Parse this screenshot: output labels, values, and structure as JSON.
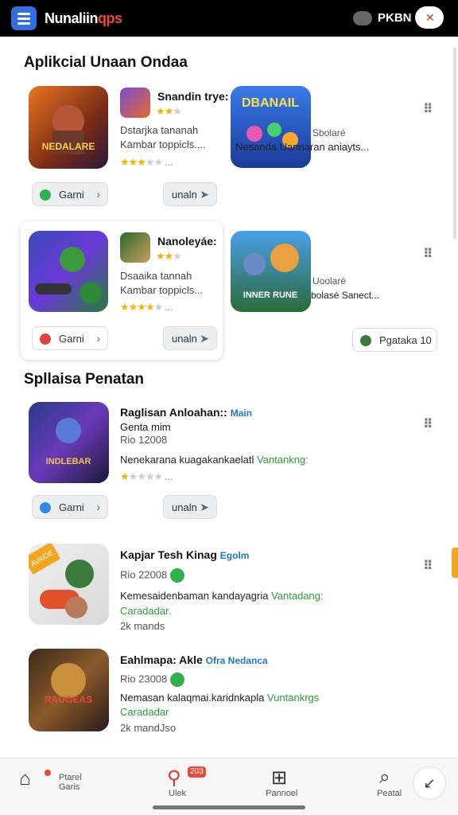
{
  "header": {
    "logo_main": "Nunaliin",
    "logo_accent": "qps",
    "status_text": "PKBN",
    "profile_icon": "user-icon"
  },
  "section1": {
    "title": "Aplikcial Unaan Ondaa",
    "cards": [
      {
        "name": "Snandin trye:",
        "rating_dots": "...",
        "desc_line1": "Dstarjka tananah",
        "desc_line2": "Kambar toppicls....",
        "chip_label": "Garni",
        "chip_icon_color": "#2fb04b",
        "icon_text": "NEDALARE"
      },
      {
        "name": "Nanoleyáe:",
        "rating_dots": "...",
        "desc_line1": "Dsaaika tannah",
        "desc_line2": "Kambar toppicls...",
        "chip_label": "Garni",
        "chip_icon_color": "#e04242"
      }
    ],
    "right_cards": [
      {
        "icon_text": "DBANAIL",
        "side_text": "Sbolaré",
        "desc": "Nesanda Uannaran aniayts...",
        "button_label": "unaln"
      },
      {
        "icon_text": "INNER RUNE",
        "side_text": "Uoolaré",
        "desc": "bolasé Sanect...",
        "button_label": "unaln",
        "pill_label": "Pgataka 10"
      }
    ]
  },
  "section2": {
    "title": "Spllaisa Penatan",
    "items": [
      {
        "name": "Raglisan Anloahan::",
        "tag": "Main",
        "sub": "Genta mim",
        "meta": "Rio 12008",
        "desc": "Nenekarana kuagakankaelatl",
        "desc_green": "Vantankng:",
        "rating_dots": "...",
        "chip_label": "Garni",
        "chip_icon_color": "#2f8ee0",
        "button_label": "unaln",
        "icon_text": "INDLEBAR"
      },
      {
        "name": "Kapjar Tesh Kinag",
        "tag": "Egolm",
        "meta": "Rio 22008",
        "desc": "Kemesaidenbaman kandayagria",
        "desc_green": "Vantadang:",
        "desc_green2": "Caradadar.",
        "downloads": "2k mands",
        "ribbon": "AVAIDE"
      },
      {
        "name": "Eahlmapa: Akle",
        "tag": "Ofra Nedanca",
        "meta": "Rio 23008",
        "desc": "Nemasan kalaqmai.karidnkapla",
        "desc_green": "Vuntankrgs",
        "desc_green2": "Caradadar",
        "downloads": "2k mandJso",
        "icon_text": "RAUGEAS"
      }
    ]
  },
  "bottom_nav": {
    "items": [
      {
        "label1": "Ptarel",
        "label2": "Garis",
        "icon": "home-icon"
      },
      {
        "label1": "Ulek",
        "badge": "203",
        "icon": "location-icon"
      },
      {
        "label1": "Pannoel",
        "icon": "photo-icon"
      },
      {
        "label1": "Peatal",
        "icon": "search-icon"
      }
    ]
  },
  "colors": {
    "accent_blue": "#2f6fe0",
    "star": "#f2b400",
    "green": "#2c9a3b",
    "orange": "#f2a51d"
  }
}
